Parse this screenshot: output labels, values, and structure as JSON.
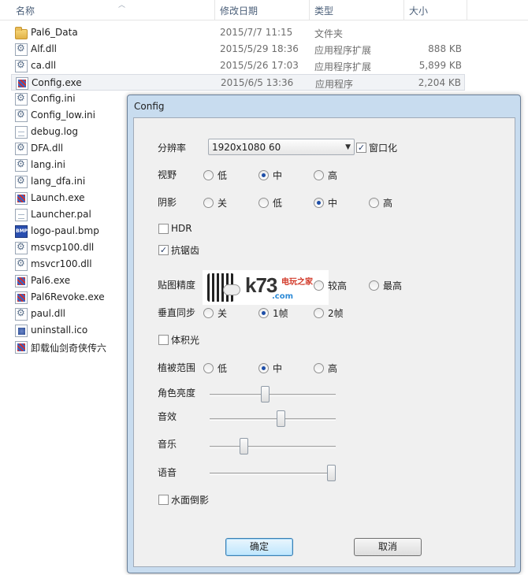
{
  "explorer": {
    "columns": {
      "name": "名称",
      "date": "修改日期",
      "type": "类型",
      "size": "大小"
    },
    "files": [
      {
        "name": "Pal6_Data",
        "date": "2015/7/7 11:15",
        "type": "文件夹",
        "size": "",
        "icon": "folder-icon"
      },
      {
        "name": "Alf.dll",
        "date": "2015/5/29 18:36",
        "type": "应用程序扩展",
        "size": "888 KB",
        "icon": "dll-file-icon"
      },
      {
        "name": "ca.dll",
        "date": "2015/5/26 17:03",
        "type": "应用程序扩展",
        "size": "5,899 KB",
        "icon": "dll-file-icon"
      },
      {
        "name": "Config.exe",
        "date": "2015/6/5 13:36",
        "type": "应用程序",
        "size": "2,204 KB",
        "icon": "exe-icon",
        "selected": true
      },
      {
        "name": "Config.ini",
        "icon": "ini-file-icon"
      },
      {
        "name": "Config_low.ini",
        "icon": "ini-file-icon"
      },
      {
        "name": "debug.log",
        "icon": "log-file-icon"
      },
      {
        "name": "DFA.dll",
        "icon": "dll-file-icon"
      },
      {
        "name": "lang.ini",
        "icon": "ini-file-icon"
      },
      {
        "name": "lang_dfa.ini",
        "icon": "ini-file-icon"
      },
      {
        "name": "Launch.exe",
        "icon": "exe-icon"
      },
      {
        "name": "Launcher.pal",
        "icon": "file-icon"
      },
      {
        "name": "logo-paul.bmp",
        "icon": "bmp-file-icon"
      },
      {
        "name": "msvcp100.dll",
        "icon": "dll-file-icon"
      },
      {
        "name": "msvcr100.dll",
        "icon": "dll-file-icon"
      },
      {
        "name": "Pal6.exe",
        "icon": "exe-icon"
      },
      {
        "name": "Pal6Revoke.exe",
        "icon": "exe-icon"
      },
      {
        "name": "paul.dll",
        "icon": "dll-file-icon"
      },
      {
        "name": "uninstall.ico",
        "icon": "ico-file-icon"
      },
      {
        "name": "卸载仙剑奇侠传六",
        "icon": "uninstall-shortcut-icon"
      }
    ]
  },
  "dialog": {
    "title": "Config",
    "resolution": {
      "label": "分辨率",
      "value": "1920x1080 60",
      "windowed_label": "窗口化",
      "windowed_checked": true
    },
    "fov": {
      "label": "视野",
      "options": [
        "低",
        "中",
        "高"
      ],
      "selected": "中"
    },
    "shadow": {
      "label": "阴影",
      "options": [
        "关",
        "低",
        "中",
        "高"
      ],
      "selected": "中"
    },
    "hdr": {
      "label": "HDR",
      "checked": false
    },
    "antialias": {
      "label": "抗锯齿",
      "checked": true
    },
    "texture": {
      "label": "贴图精度",
      "options": [
        "较高",
        "最高"
      ],
      "selected": ""
    },
    "vsync": {
      "label": "垂直同步",
      "options": [
        "关",
        "1帧",
        "2帧"
      ],
      "selected": "1帧"
    },
    "volumetric": {
      "label": "体积光",
      "checked": false
    },
    "vegetation": {
      "label": "植被范围",
      "options": [
        "低",
        "中",
        "高"
      ],
      "selected": "中"
    },
    "sliders": [
      {
        "label": "角色亮度",
        "value": 0.44
      },
      {
        "label": "音效",
        "value": 0.56
      },
      {
        "label": "音乐",
        "value": 0.27
      },
      {
        "label": "语音",
        "value": 0.96
      }
    ],
    "water": {
      "label": "水面倒影",
      "checked": false
    },
    "ok_label": "确定",
    "cancel_label": "取消"
  },
  "logo": {
    "brand": "k73",
    "sub": "电玩之家",
    "domain": ".com"
  }
}
